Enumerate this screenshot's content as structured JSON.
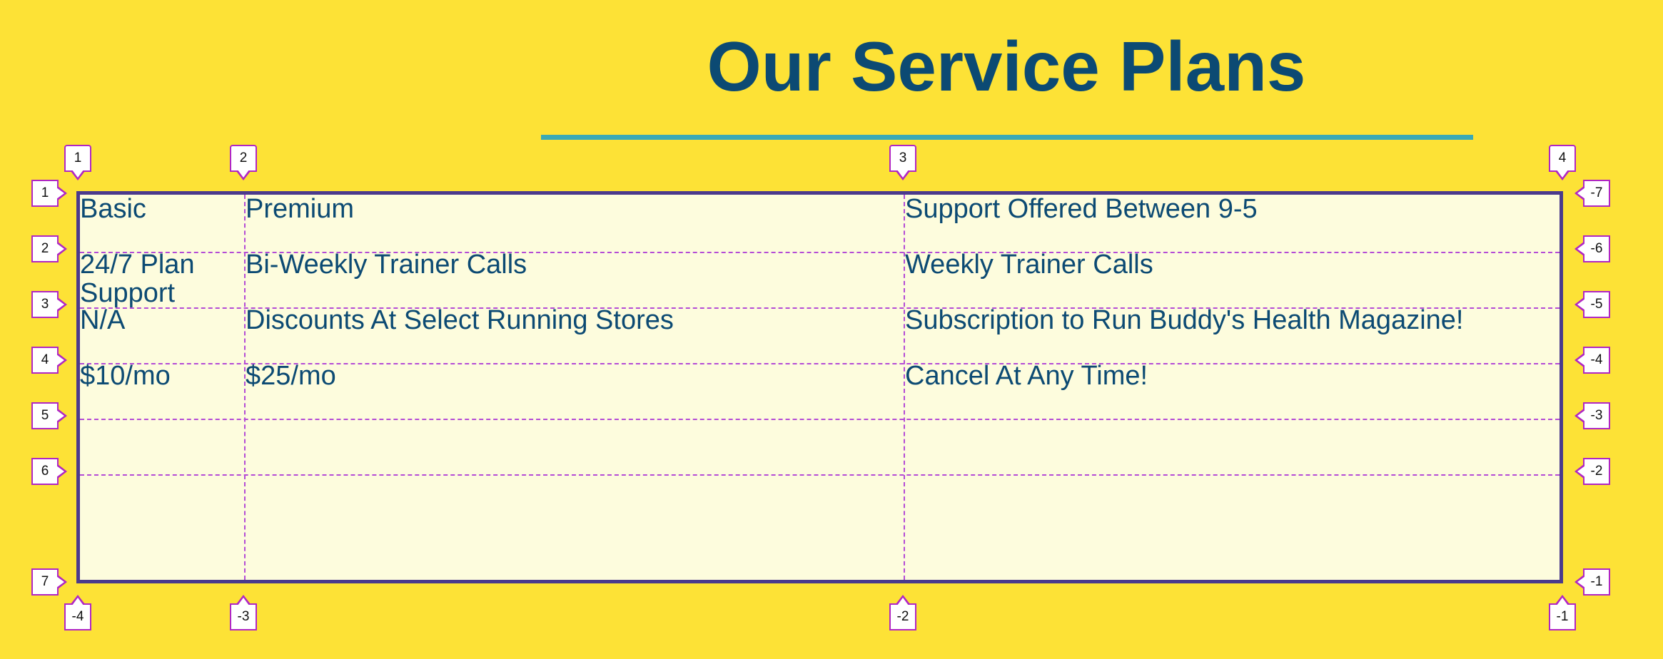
{
  "page": {
    "title": "Our Service Plans"
  },
  "colors": {
    "background": "#fde236",
    "title_text": "#0c4a73",
    "underline": "#3aa9b5",
    "grid_fill": "#fdfcdd",
    "grid_border": "#4b3a8c",
    "grid_lines": "#b44bd6"
  },
  "grid": {
    "rows": [
      [
        "Basic",
        "Premium",
        "Support Offered Between 9-5"
      ],
      [
        "24/7 Plan Support",
        "Bi-Weekly Trainer Calls",
        "Weekly Trainer Calls"
      ],
      [
        "N/A",
        "Discounts At Select Running Stores",
        "Subscription to Run Buddy's Health Magazine!"
      ],
      [
        "$10/mo",
        "$25/mo",
        "Cancel At Any Time!"
      ]
    ]
  },
  "overlay": {
    "column_numbers": [
      "1",
      "2",
      "3",
      "4"
    ],
    "column_numbers_negative": [
      "-4",
      "-3",
      "-2",
      "-1"
    ],
    "row_numbers": [
      "1",
      "2",
      "3",
      "4",
      "5",
      "6",
      "7"
    ],
    "row_numbers_negative": [
      "-7",
      "-6",
      "-5",
      "-4",
      "-3",
      "-2",
      "-1"
    ]
  }
}
